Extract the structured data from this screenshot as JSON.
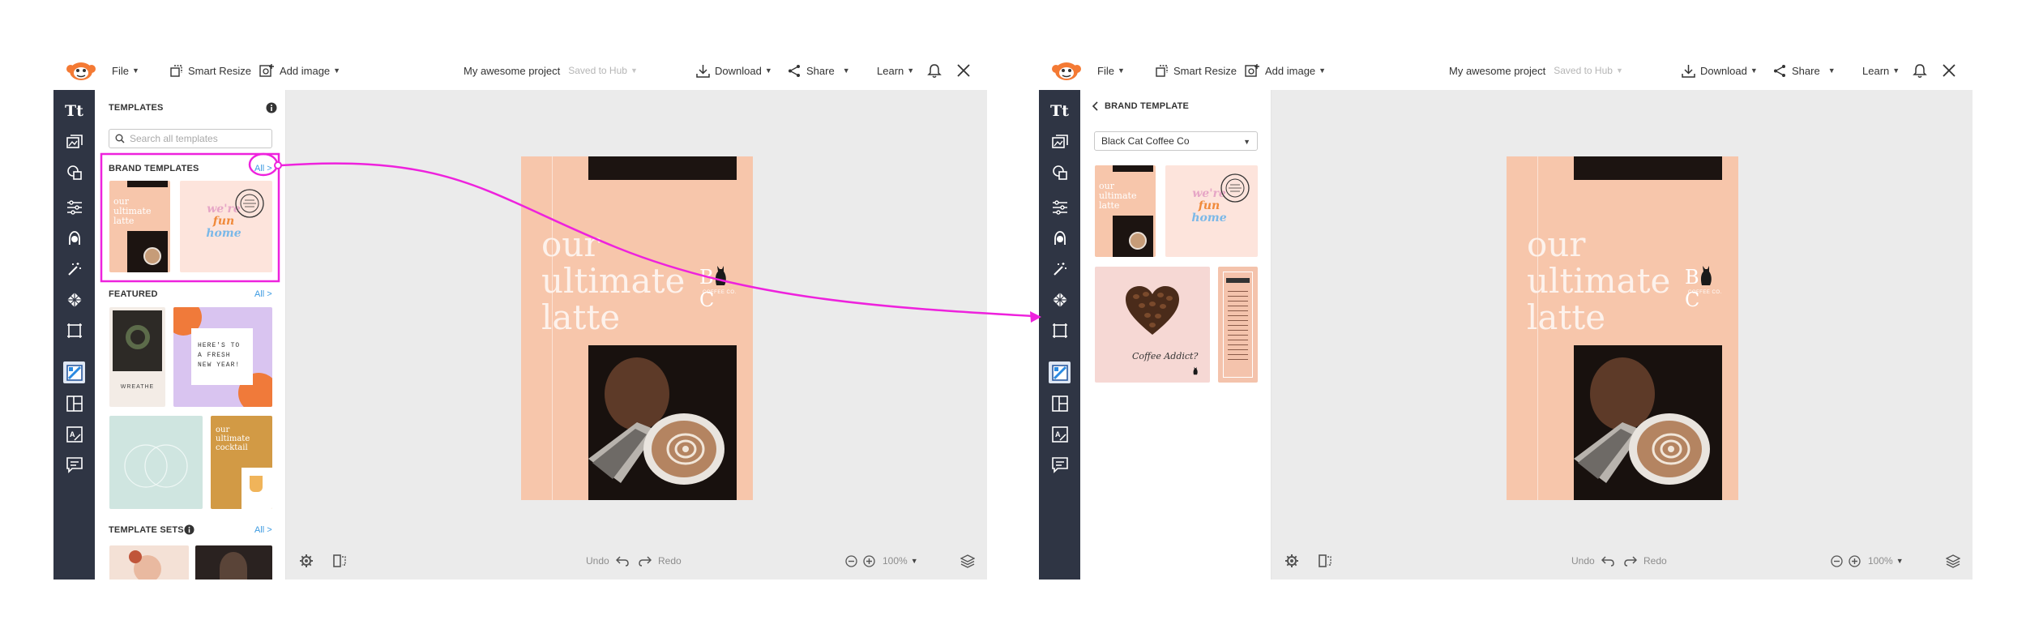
{
  "colors": {
    "rail": "#2f3544",
    "canvas": "#ebebeb",
    "accent_link": "#3b9ae1",
    "highlight_annotation": "#ee22dd",
    "design_bg": "#f7c6ab"
  },
  "topbar": {
    "logo_icon": "picmonkey-logo-icon",
    "file_label": "File",
    "smart_resize_label": "Smart Resize",
    "add_image_label": "Add image",
    "project_name": "My awesome project",
    "saved_status": "Saved to Hub",
    "download_label": "Download",
    "share_label": "Share",
    "learn_label": "Learn",
    "notification_icon": "bell-icon",
    "close_icon": "close-icon"
  },
  "toolrail": {
    "tools": [
      "text-icon",
      "image-icon",
      "graphics-icon",
      "adjust-icon",
      "touch-up-icon",
      "effects-icon",
      "textures-icon",
      "frames-icon",
      "templates-icon",
      "collage-icon",
      "brand-kit-icon",
      "comments-icon"
    ],
    "active_tool": "templates-icon"
  },
  "left_sidebar": {
    "title": "TEMPLATES",
    "search_placeholder": "Search all templates",
    "brand_templates_title": "BRAND TEMPLATES",
    "brand_all_link": "All >",
    "featured_title": "FEATURED",
    "featured_all_link": "All >",
    "featured_items": [
      {
        "caption": "WREATHE"
      },
      {
        "caption": "HERE'S TO A FRESH NEW YEAR!"
      },
      {
        "caption": ""
      },
      {
        "caption": "our ultimate cocktail"
      }
    ],
    "template_sets_title": "TEMPLATE SETS",
    "template_sets_all_link": "All >"
  },
  "right_sidebar": {
    "back_label": "BRAND TEMPLATE",
    "brand_select_value": "Black Cat Coffee Co",
    "heart_caption": "Coffee Addict?"
  },
  "design": {
    "headline_lines": [
      "our",
      "ultimate",
      "latte"
    ],
    "logo_text": "B C",
    "logo_sub": "COFFEE CO."
  },
  "thumb_texts": {
    "latte_small": "our ultimate latte",
    "fun_home_line1": "we're",
    "fun_home_line2": "fun",
    "fun_home_line3": "home"
  },
  "bottombar": {
    "settings_icon": "gear-icon",
    "fit_icon": "compare-icon",
    "undo_label": "Undo",
    "redo_label": "Redo",
    "zoom_level": "100%",
    "layers_icon": "layers-icon"
  }
}
